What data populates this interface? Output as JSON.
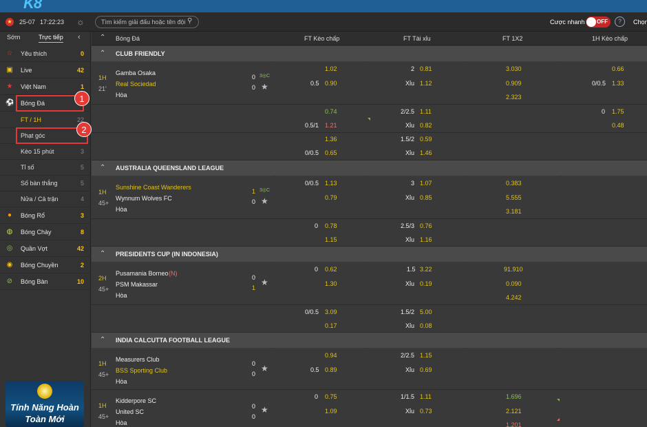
{
  "header": {
    "logo": "K8",
    "date": "25-07",
    "time": "17:22:23",
    "search_placeholder": "Tìm kiếm giải đấu hoặc tên đội",
    "quick_bet": "Cược nhanh",
    "toggle": "OFF",
    "help": "?",
    "choose": "Chọn"
  },
  "sidebar": {
    "tabs": [
      "Sớm",
      "Trực tiếp"
    ],
    "items": [
      {
        "label": "Yêu thích",
        "count": "0",
        "icon": "star-outline-icon",
        "color": "#e53935"
      },
      {
        "label": "Live",
        "count": "42",
        "icon": "tv-icon",
        "color": "#f5c518"
      },
      {
        "label": "Việt Nam",
        "count": "1",
        "icon": "vietnam-flag-icon",
        "color": "#e53935"
      },
      {
        "label": "Bóng Đá",
        "count": "",
        "icon": "soccer-ball-icon",
        "color": "#8bc34a"
      },
      {
        "label": "FT / 1H",
        "count": "22",
        "sub": true
      },
      {
        "label": "Phạt góc",
        "count": "",
        "sub": true
      },
      {
        "label": "Kèo 15 phút",
        "count": "3",
        "sub": true
      },
      {
        "label": "Tỉ số",
        "count": "5",
        "sub": true
      },
      {
        "label": "Số bàn thắng",
        "count": "5",
        "sub": true
      },
      {
        "label": "Nửa / Cả trận",
        "count": "4",
        "sub": true
      },
      {
        "label": "Bóng Rổ",
        "count": "3",
        "icon": "basketball-icon",
        "color": "#ff9800"
      },
      {
        "label": "Bóng Chày",
        "count": "8",
        "icon": "baseball-icon",
        "color": "#cddc39"
      },
      {
        "label": "Quần Vợt",
        "count": "42",
        "icon": "tennis-icon",
        "color": "#8bc34a"
      },
      {
        "label": "Bóng Chuyền",
        "count": "2",
        "icon": "volleyball-icon",
        "color": "#ffc107"
      },
      {
        "label": "Bóng Bàn",
        "count": "10",
        "icon": "table-tennis-icon",
        "color": "#8bc34a"
      }
    ],
    "annotations": [
      "1",
      "2"
    ],
    "promo_line1": "Tính Năng Hoàn",
    "promo_line2": "Toàn Mới"
  },
  "table": {
    "sport": "Bóng Đá",
    "columns": [
      "FT Kèo chấp",
      "FT Tài xỉu",
      "FT 1X2",
      "1H Kèo chấp"
    ],
    "leagues": [
      {
        "name": "CLUB FRIENDLY",
        "matches": [
          {
            "period": "1H",
            "minute": "21'",
            "home": "Gamba Osaka",
            "away": "Real Sociedad",
            "draw": "Hòa",
            "home_score": "0",
            "away_score": "0",
            "away_highlight": true,
            "lines": [
              {
                "hdp": "",
                "hdp_odds1": "1.02",
                "hdp_odds2": "0.90",
                "hdp2": "0.5",
                "ou": "2",
                "ou_odds1": "0.81",
                "ou_label": "Xỉu",
                "ou_odds2": "1.12",
                "x1": "3.030",
                "x2": "0.909",
                "x3": "2.323",
                "h1": "",
                "h1o1": "0.66",
                "h1l": "0/0.5",
                "h1o2": "1.33"
              }
            ]
          },
          {
            "sublines": [
              {
                "hdp": "0.5/1",
                "o1": "0.74",
                "o2": "1.21",
                "ou": "2/2.5",
                "ouo1": "1.11",
                "oulbl": "Xỉu",
                "ouo2": "0.82",
                "h1": "0",
                "h1o1": "1.75",
                "h1o2": "0.48"
              },
              {
                "hdp": "0/0.5",
                "o1": "1.36",
                "o2": "0.65",
                "ou": "1.5/2",
                "ouo1": "0.59",
                "oulbl": "Xỉu",
                "ouo2": "1.46"
              }
            ]
          }
        ]
      },
      {
        "name": "AUSTRALIA QUEENSLAND LEAGUE",
        "matches": [
          {
            "period": "1H",
            "minute": "45+",
            "home": "Sunshine Coast Wanderers",
            "away": "Wynnum Wolves FC",
            "draw": "Hòa",
            "home_score": "1",
            "away_score": "0",
            "hdp": "0/0.5",
            "o1": "1.13",
            "o2": "0.79",
            "ou": "3",
            "ouo1": "1.07",
            "oulbl": "Xỉu",
            "ouo2": "0.85",
            "x1": "0.383",
            "x2": "5.555",
            "x3": "3.181"
          },
          {
            "sublines": [
              {
                "hdp": "0",
                "o1": "0.78",
                "o2": "1.15",
                "ou": "2.5/3",
                "ouo1": "0.76",
                "oulbl": "Xỉu",
                "ouo2": "1.16"
              }
            ]
          }
        ]
      },
      {
        "name": "PRESIDENTS CUP (IN INDONESIA)",
        "matches": [
          {
            "period": "2H",
            "minute": "45+",
            "home": "Pusamania Borneo",
            "neutral": "(N)",
            "away": "PSM Makassar",
            "draw": "Hòa",
            "home_score": "0",
            "away_score": "1",
            "hdp": "0",
            "o1": "0.62",
            "o2": "1.30",
            "ou": "1.5",
            "ouo1": "3.22",
            "oulbl": "Xỉu",
            "ouo2": "0.19",
            "x1": "91.910",
            "x2": "0.090",
            "x3": "4.242"
          },
          {
            "sublines": [
              {
                "hdp": "0/0.5",
                "o1": "3.09",
                "o2": "0.17",
                "ou": "1.5/2",
                "ouo1": "5.00",
                "oulbl": "Xỉu",
                "ouo2": "0.08"
              }
            ]
          }
        ]
      },
      {
        "name": "INDIA CALCUTTA FOOTBALL LEAGUE",
        "matches": [
          {
            "period": "1H",
            "minute": "45+",
            "home": "Measurers Club",
            "away": "BSS Sporting Club",
            "draw": "Hòa",
            "home_score": "0",
            "away_score": "0",
            "away_highlight": true,
            "hdp": "0.5",
            "o1": "0.94",
            "o2": "0.89",
            "ou": "2/2.5",
            "ouo1": "1.15",
            "oulbl": "Xỉu",
            "ouo2": "0.69"
          },
          {
            "period": "1H",
            "minute": "45+",
            "home": "Kidderpore SC",
            "away": "United SC",
            "draw": "Hòa",
            "home_score": "0",
            "away_score": "0",
            "hdp": "0",
            "o1": "0.75",
            "o2": "1.09",
            "ou": "1/1.5",
            "ouo1": "1.11",
            "oulbl": "Xỉu",
            "ouo2": "0.73",
            "x1": "1.696",
            "x2": "2.121",
            "x3": "1.201"
          }
        ]
      }
    ]
  },
  "colors": {
    "accent": "#f5c518",
    "topbar": "#1f5f96",
    "annotation": "#e53935",
    "odds_up": "#8bc34a",
    "odds_down": "#e57373"
  }
}
